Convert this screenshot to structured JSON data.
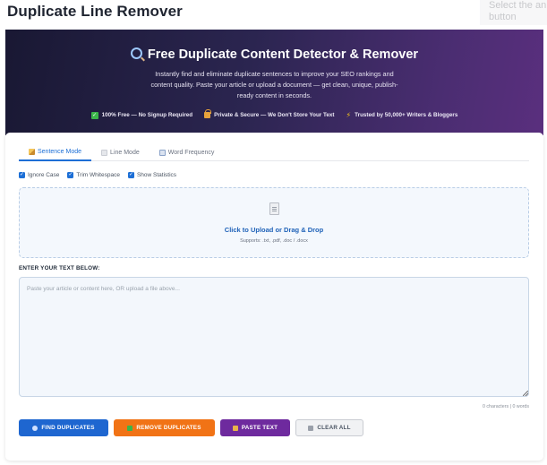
{
  "page": {
    "title": "Duplicate Line Remover",
    "ghost_text": "Select the an button"
  },
  "hero": {
    "title": "Free Duplicate Content Detector & Remover",
    "title_icon": "magnifier-icon",
    "description": "Instantly find and eliminate duplicate sentences to improve your SEO rankings and content quality. Paste your article or upload a document — get clean, unique, publish-ready content in seconds.",
    "badges": [
      {
        "icon": "check-icon",
        "label": "100% Free — No Signup Required"
      },
      {
        "icon": "lock-icon",
        "label": "Private & Secure — We Don't Store Your Text"
      },
      {
        "icon": "bolt-icon",
        "label": "Trusted by 50,000+ Writers & Bloggers"
      }
    ]
  },
  "tabs": [
    {
      "label": "Sentence Mode",
      "icon": "pencil-icon",
      "active": true
    },
    {
      "label": "Line Mode",
      "icon": "list-icon",
      "active": false
    },
    {
      "label": "Word Frequency",
      "icon": "chart-icon",
      "active": false
    }
  ],
  "options": [
    {
      "label": "Ignore Case",
      "checked": true
    },
    {
      "label": "Trim Whitespace",
      "checked": true
    },
    {
      "label": "Show Statistics",
      "checked": true
    }
  ],
  "upload": {
    "label": "Click to Upload or Drag & Drop",
    "supports": "Supports: .txt, .pdf, .doc / .docx"
  },
  "editor": {
    "label": "ENTER YOUR TEXT BELOW:",
    "placeholder": "Paste your article or content here, OR upload a file above...",
    "counter": "0 characters | 0 words"
  },
  "buttons": {
    "find": "FIND DUPLICATES",
    "remove": "REMOVE DUPLICATES",
    "paste": "PASTE TEXT",
    "clear": "CLEAR ALL"
  },
  "colors": {
    "accent_blue": "#1e66d0",
    "accent_orange": "#f17316",
    "accent_purple": "#6e2a9e",
    "hero_start": "#191833",
    "hero_end": "#5a2f7e"
  }
}
